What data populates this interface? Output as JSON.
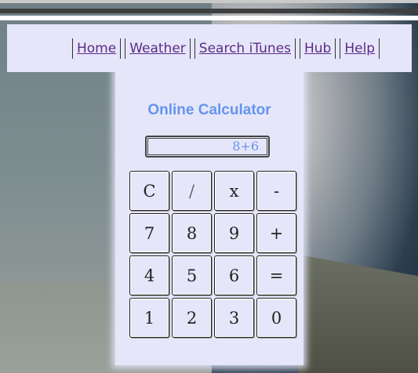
{
  "nav": {
    "links": [
      {
        "label": "Home"
      },
      {
        "label": "Weather"
      },
      {
        "label": "Search iTunes"
      },
      {
        "label": "Hub"
      },
      {
        "label": "Help"
      }
    ]
  },
  "calculator": {
    "title": "Online Calculator",
    "display_value": "8+6",
    "keys": [
      [
        "C",
        "/",
        "x",
        "-"
      ],
      [
        "7",
        "8",
        "9",
        "+"
      ],
      [
        "4",
        "5",
        "6",
        "="
      ],
      [
        "1",
        "2",
        "3",
        "0"
      ]
    ]
  },
  "colors": {
    "panel": "#e6e6fa",
    "title": "#6495ed",
    "link": "#5b2c86"
  }
}
